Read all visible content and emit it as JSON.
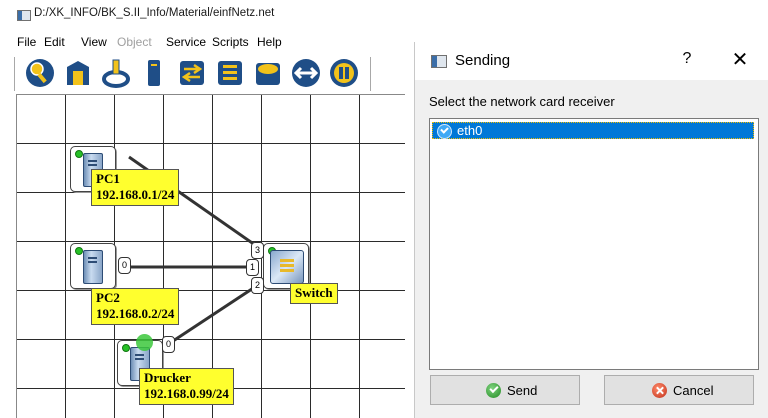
{
  "app": {
    "title": "D:/XK_INFO/BK_S.II_Info/Material/einfNetz.net",
    "menu": [
      {
        "label": "File",
        "enabled": true
      },
      {
        "label": "Edit",
        "enabled": true
      },
      {
        "label": "View",
        "enabled": true
      },
      {
        "label": "Object",
        "enabled": false
      },
      {
        "label": "Service",
        "enabled": true
      },
      {
        "label": "Scripts",
        "enabled": true
      },
      {
        "label": "Help",
        "enabled": true
      }
    ],
    "toolbar": [
      "magnifier-icon",
      "building-icon",
      "cable-icon",
      "computer-icon",
      "switch-icon",
      "router-icon",
      "cloud-icon",
      "link-icon",
      "pause-icon"
    ]
  },
  "network": {
    "pc1": {
      "name": "PC1",
      "ip": "192.168.0.1/24"
    },
    "pc2": {
      "name": "PC2",
      "ip": "192.168.0.2/24",
      "port": "0"
    },
    "printer": {
      "name": "Drucker",
      "ip": "192.168.0.99/24",
      "port": "0"
    },
    "switch": {
      "name": "Switch",
      "ports": [
        "3",
        "1",
        "2"
      ]
    }
  },
  "dialog": {
    "title": "Sending",
    "help": "?",
    "close": "✕",
    "prompt": "Select the network card receiver",
    "items": [
      {
        "label": "eth0",
        "selected": true
      }
    ],
    "send_label": "Send",
    "cancel_label": "Cancel"
  },
  "colors": {
    "label_bg": "#ffff2e",
    "selection": "#0078d7",
    "status_led": "#27c027"
  }
}
